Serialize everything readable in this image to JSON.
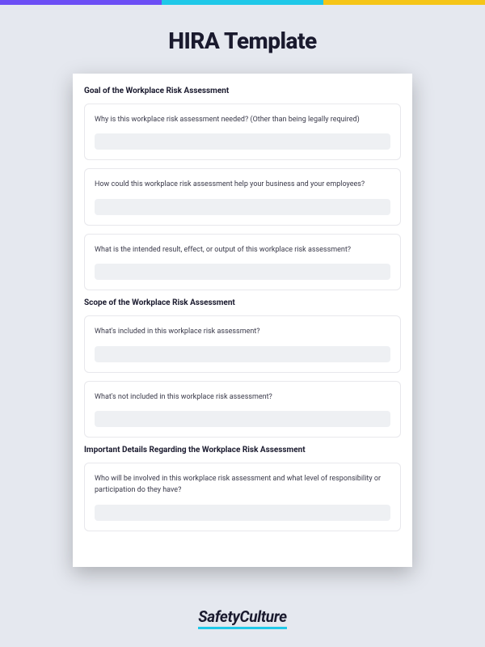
{
  "title": "HIRA Template",
  "brand": "SafetyCulture",
  "colors": {
    "purple": "#6c4ef5",
    "cyan": "#1fc8e8",
    "yellow": "#f5c518"
  },
  "sections": [
    {
      "header": "Goal of the Workplace Risk Assessment",
      "questions": [
        "Why is this workplace risk assessment needed? (Other than being legally required)",
        "How could this workplace risk assessment help your business and your employees?",
        "What is the intended result, effect, or output of this workplace risk assessment?"
      ]
    },
    {
      "header": "Scope of the Workplace Risk Assessment",
      "questions": [
        "What's included in this workplace risk assessment?",
        "What's not included in this workplace risk assessment?"
      ]
    },
    {
      "header": "Important Details Regarding the Workplace Risk Assessment",
      "questions": [
        "Who will be involved in this workplace risk assessment and what level of responsibility or participation do they have?"
      ]
    }
  ]
}
